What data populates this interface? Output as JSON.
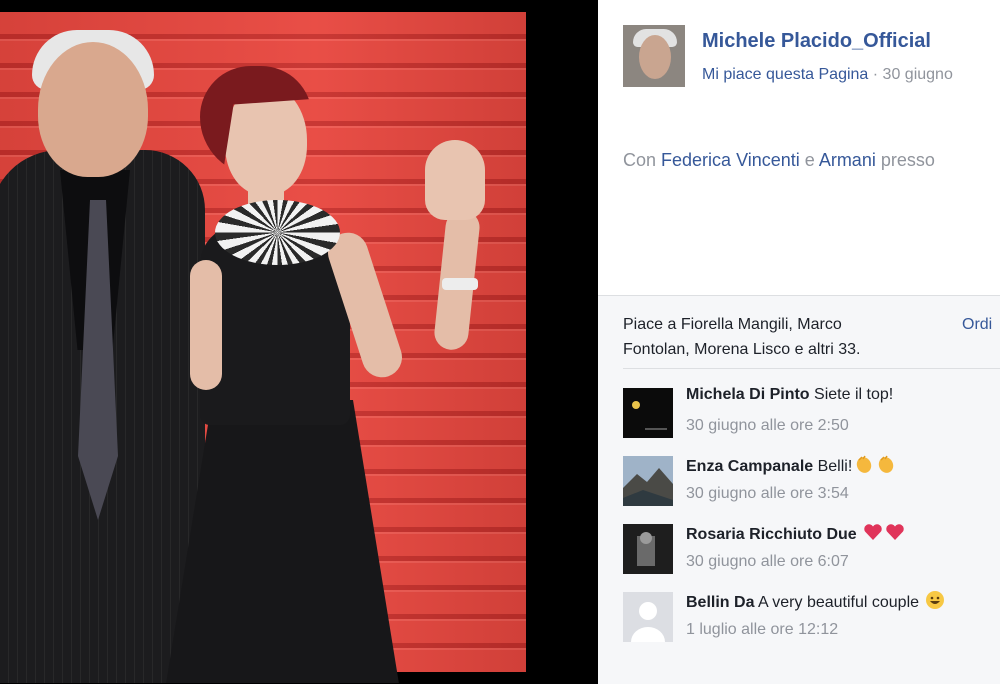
{
  "post": {
    "page_name": "Michele Placido_Official",
    "like_page": "Mi piace questa Pagina",
    "separator": " · ",
    "date": "30 giugno",
    "caption_prefix": "Con ",
    "tag1": "Federica Vincenti",
    "caption_and": " e ",
    "tag2": "Armani",
    "caption_suffix": " presso"
  },
  "reactions": {
    "likes_text": "Piace a Fiorella Mangili, Marco Fontolan, Morena Lisco e altri 33.",
    "sort_label": "Ordi"
  },
  "comments": [
    {
      "author": "Michela Di Pinto",
      "text": " Siete il top!",
      "time": "30 giugno alle ore 2:50",
      "emoji": ""
    },
    {
      "author": "Enza Campanale",
      "text": " Belli!",
      "time": "30 giugno alle ore 3:54",
      "emoji": "clap-clap"
    },
    {
      "author": "Rosaria Ricchiuto Due",
      "text": " ",
      "time": "30 giugno alle ore 6:07",
      "emoji": "heart-heart"
    },
    {
      "author": "Bellin Da",
      "text": " A very beautiful couple ",
      "time": "1 luglio alle ore 12:12",
      "emoji": "smile"
    }
  ],
  "colors": {
    "link": "#365899",
    "muted": "#90949c",
    "text": "#1d2129",
    "carpet": "#e8473f"
  }
}
